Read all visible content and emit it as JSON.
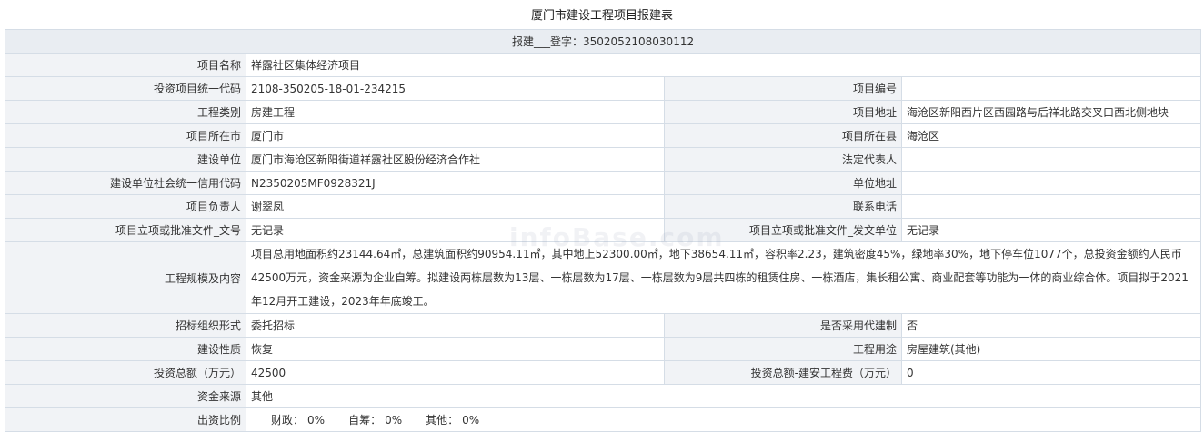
{
  "title": "厦门市建设工程项目报建表",
  "registration": "报建___登字：3502052108030112",
  "watermark": "infoBase.com",
  "rows": {
    "project_name": {
      "label": "项目名称",
      "value": "祥露社区集体经济项目"
    },
    "investment_code": {
      "label": "投资项目统一代码",
      "value": "2108-350205-18-01-234215"
    },
    "project_number": {
      "label": "项目编号",
      "value": ""
    },
    "engineering_type": {
      "label": "工程类别",
      "value": "房建工程"
    },
    "project_address": {
      "label": "项目地址",
      "value": "海沧区新阳西片区西园路与后祥北路交叉口西北侧地块"
    },
    "city": {
      "label": "项目所在市",
      "value": "厦门市"
    },
    "county": {
      "label": "项目所在县",
      "value": "海沧区"
    },
    "builder": {
      "label": "建设单位",
      "value": "厦门市海沧区新阳街道祥露社区股份经济合作社"
    },
    "legal_rep": {
      "label": "法定代表人",
      "value": ""
    },
    "credit_code": {
      "label": "建设单位社会统一信用代码",
      "value": "N2350205MF0928321J"
    },
    "unit_address": {
      "label": "单位地址",
      "value": ""
    },
    "person_in_charge": {
      "label": "项目负责人",
      "value": "谢翠凤"
    },
    "phone": {
      "label": "联系电话",
      "value": ""
    },
    "approval_doc_no": {
      "label": "项目立项或批准文件_文号",
      "value": "无记录"
    },
    "approval_issuer": {
      "label": "项目立项或批准文件_发文单位",
      "value": "无记录"
    },
    "scale": {
      "label": "工程规模及内容",
      "value": "项目总用地面积约23144.64㎡，总建筑面积约90954.11㎡，其中地上52300.00㎡，地下38654.11㎡，容积率2.23，建筑密度45%，绿地率30%，地下停车位1077个，总投资金额约人民币42500万元，资金来源为企业自筹。拟建设两栋层数为13层、一栋层数为17层、一栋层数为9层共四栋的租赁住房、一栋酒店，集长租公寓、商业配套等功能为一体的商业综合体。项目拟于2021年12月开工建设，2023年年底竣工。"
    },
    "tender_form": {
      "label": "招标组织形式",
      "value": "委托招标"
    },
    "agent_system": {
      "label": "是否采用代建制",
      "value": "否"
    },
    "nature": {
      "label": "建设性质",
      "value": "恢复"
    },
    "usage": {
      "label": "工程用途",
      "value": "房屋建筑(其他)"
    },
    "total_investment": {
      "label": "投资总额（万元）",
      "value": "42500"
    },
    "construction_cost": {
      "label": "投资总额-建安工程费（万元）",
      "value": "0"
    },
    "fund_source": {
      "label": "资金来源",
      "value": "其他"
    },
    "ratio": {
      "label": "出资比例",
      "finance_label": "财政：",
      "finance_value": "0%",
      "self_label": "自筹：",
      "self_value": "0%",
      "other_label": "其他：",
      "other_value": "0%"
    }
  }
}
